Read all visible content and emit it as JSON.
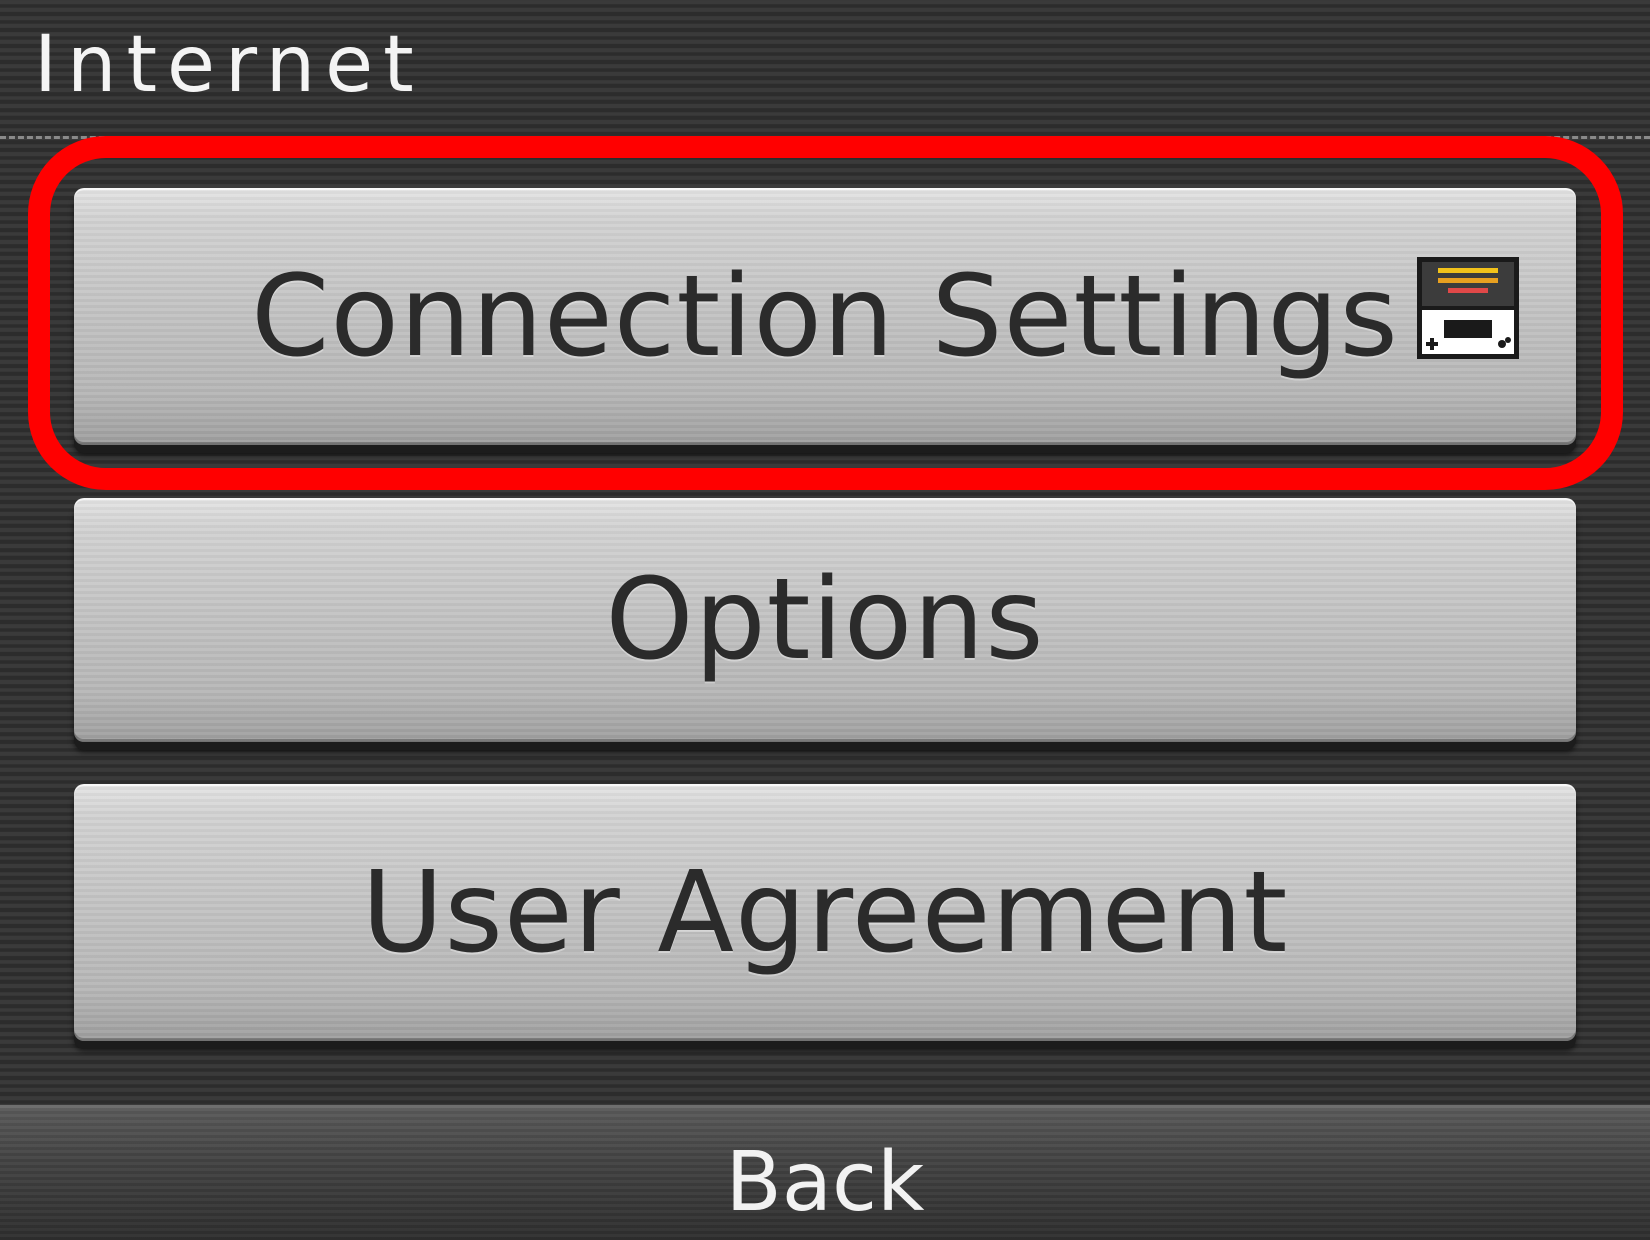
{
  "header": {
    "title": "Internet"
  },
  "menu": {
    "items": [
      {
        "label": "Connection Settings",
        "icon": "system-settings-icon",
        "highlighted": true
      },
      {
        "label": "Options"
      },
      {
        "label": "User Agreement"
      }
    ]
  },
  "footer": {
    "back_label": "Back"
  },
  "colors": {
    "highlight": "#ff0000",
    "button_text": "#2b2b2b",
    "background": "#333333"
  }
}
